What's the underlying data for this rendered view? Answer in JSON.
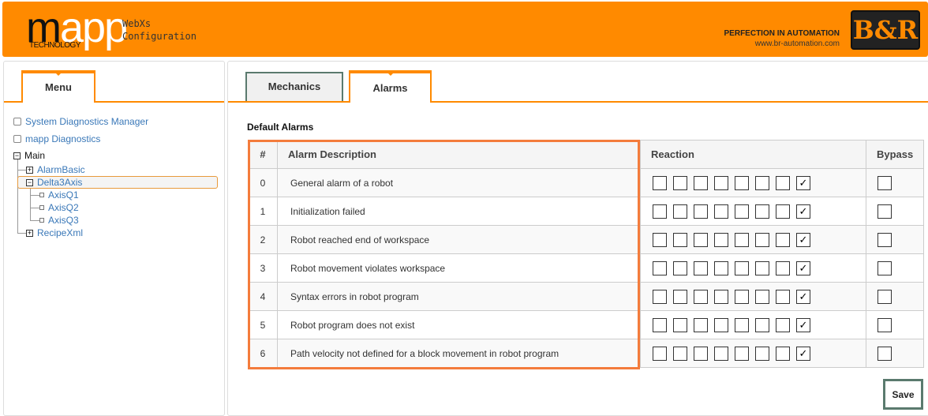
{
  "header": {
    "logo_dark": "m",
    "logo_light": "app",
    "logo_sub": "TECHNOLOGY",
    "app_line1": "WebXs",
    "app_line2": "Configuration",
    "tagline": "PERFECTION IN AUTOMATION",
    "url": "www.br-automation.com",
    "brand_logo": "B&R",
    "brand_color": "#ff8a00"
  },
  "menu": {
    "tab": "Menu",
    "items": [
      {
        "label": "System Diagnostics Manager"
      },
      {
        "label": "mapp Diagnostics"
      }
    ],
    "tree": {
      "root": "Main",
      "children": [
        {
          "label": "AlarmBasic",
          "state": "collapsed"
        },
        {
          "label": "Delta3Axis",
          "state": "expanded",
          "selected": true,
          "children": [
            "AxisQ1",
            "AxisQ2",
            "AxisQ3"
          ]
        },
        {
          "label": "RecipeXml",
          "state": "collapsed"
        }
      ]
    }
  },
  "tabs": [
    {
      "label": "Mechanics",
      "active": false
    },
    {
      "label": "Alarms",
      "active": true
    }
  ],
  "section_title": "Default Alarms",
  "table": {
    "headers": [
      "#",
      "Alarm Description",
      "Reaction",
      "Bypass"
    ],
    "rows": [
      {
        "num": "0",
        "desc": "General alarm of a robot",
        "reaction": [
          false,
          false,
          false,
          false,
          false,
          false,
          false,
          true
        ],
        "bypass": false
      },
      {
        "num": "1",
        "desc": "Initialization failed",
        "reaction": [
          false,
          false,
          false,
          false,
          false,
          false,
          false,
          true
        ],
        "bypass": false
      },
      {
        "num": "2",
        "desc": "Robot reached end of workspace",
        "reaction": [
          false,
          false,
          false,
          false,
          false,
          false,
          false,
          true
        ],
        "bypass": false
      },
      {
        "num": "3",
        "desc": "Robot movement violates workspace",
        "reaction": [
          false,
          false,
          false,
          false,
          false,
          false,
          false,
          true
        ],
        "bypass": false
      },
      {
        "num": "4",
        "desc": "Syntax errors in robot program",
        "reaction": [
          false,
          false,
          false,
          false,
          false,
          false,
          false,
          true
        ],
        "bypass": false
      },
      {
        "num": "5",
        "desc": "Robot program does not exist",
        "reaction": [
          false,
          false,
          false,
          false,
          false,
          false,
          false,
          true
        ],
        "bypass": false
      },
      {
        "num": "6",
        "desc": "Path velocity not defined for a block movement in robot program",
        "reaction": [
          false,
          false,
          false,
          false,
          false,
          false,
          false,
          true
        ],
        "bypass": false
      }
    ]
  },
  "save_label": "Save"
}
